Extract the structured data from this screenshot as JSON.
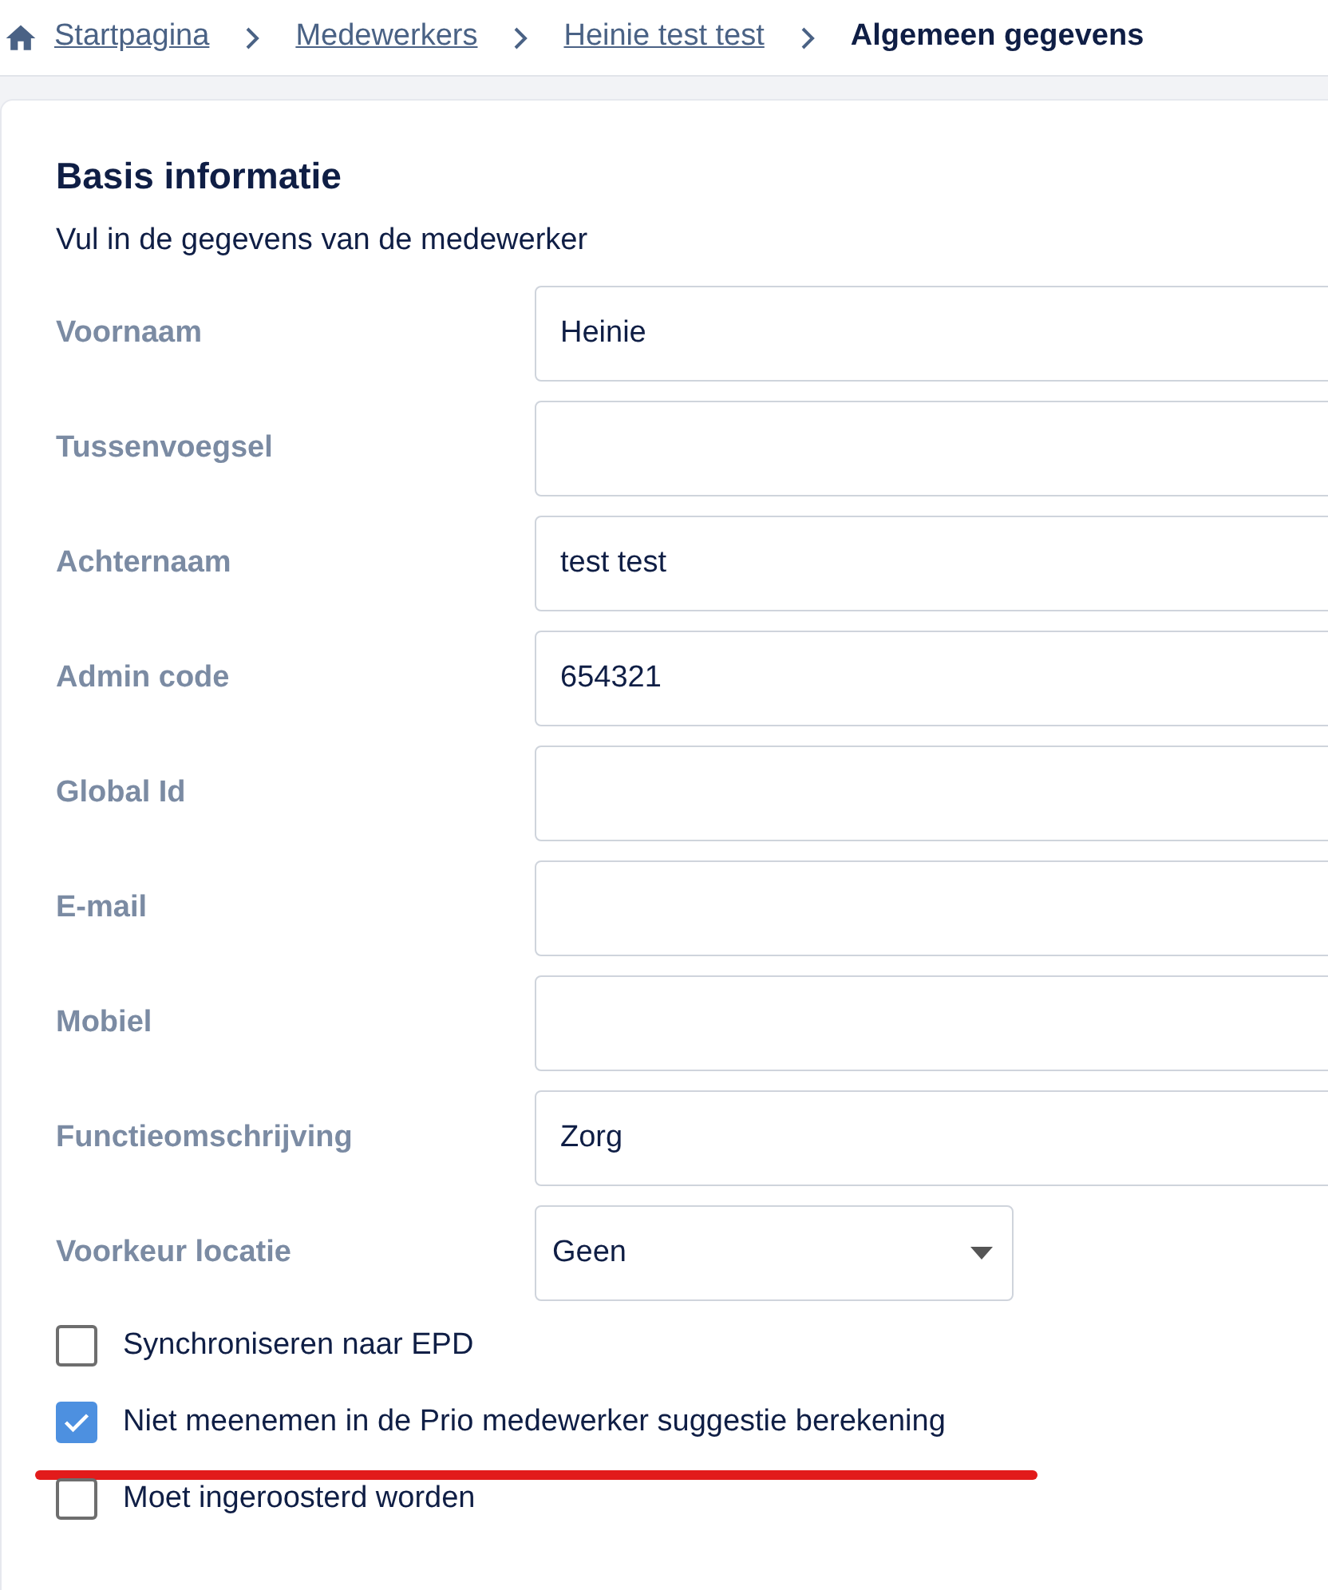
{
  "breadcrumb": [
    {
      "label": "Startpagina",
      "kind": "link"
    },
    {
      "label": "Medewerkers",
      "kind": "link"
    },
    {
      "label": "Heinie test test",
      "kind": "link"
    },
    {
      "label": "Algemeen gegevens",
      "kind": "current"
    }
  ],
  "section": {
    "title": "Basis informatie",
    "subtitle": "Vul in de gegevens van de medewerker"
  },
  "fields": [
    {
      "label": "Voornaam",
      "kind": "text",
      "value": "Heinie"
    },
    {
      "label": "Tussenvoegsel",
      "kind": "text"
    },
    {
      "label": "Achternaam",
      "kind": "text",
      "value": "test test"
    },
    {
      "label": "Admin code",
      "kind": "text",
      "value": "654321"
    },
    {
      "label": "Global Id",
      "kind": "text"
    },
    {
      "label": "E-mail",
      "kind": "text"
    },
    {
      "label": "Mobiel",
      "kind": "text"
    },
    {
      "label": "Functieomschrijving",
      "kind": "text",
      "value": "Zorg"
    },
    {
      "label": "Voorkeur locatie",
      "kind": "select",
      "value": "Geen"
    }
  ],
  "checkboxes": [
    {
      "label": "Synchroniseren naar EPD",
      "checked": false,
      "underlined": false
    },
    {
      "label": "Niet meenemen in de Prio medewerker suggestie berekening",
      "checked": true,
      "underlined": true
    },
    {
      "label": "Moet ingeroosterd worden",
      "checked": false,
      "underlined": false
    }
  ]
}
